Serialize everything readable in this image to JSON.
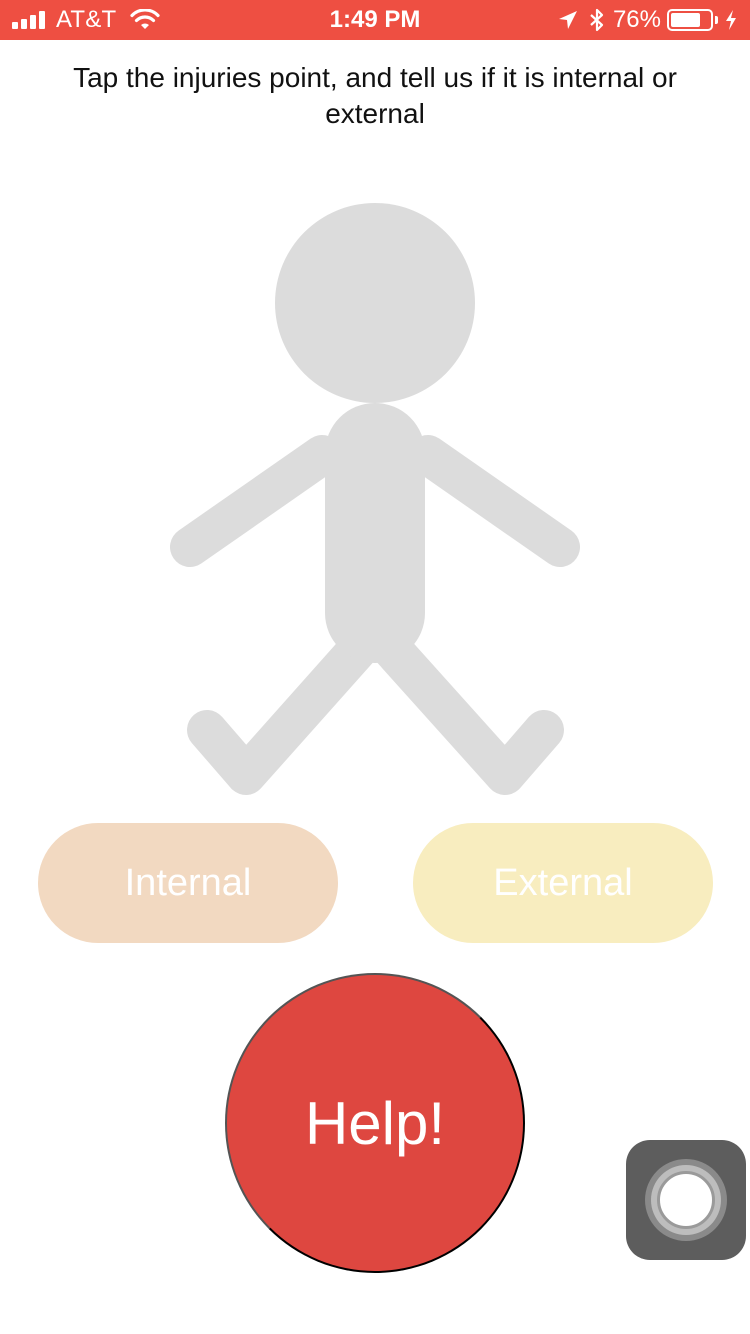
{
  "status_bar": {
    "carrier": "AT&T",
    "time": "1:49 PM",
    "battery_percent": "76%",
    "battery_level": 0.76,
    "background_color": "#ee4f42",
    "icons": [
      "signal-bars-icon",
      "wifi-icon",
      "location-arrow-icon",
      "bluetooth-icon",
      "battery-icon",
      "charging-bolt-icon"
    ]
  },
  "instruction": "Tap the injuries point, and tell us if it is internal or external",
  "body_figure": {
    "color": "#dcdcdc",
    "parts": [
      "head",
      "torso",
      "left-arm",
      "right-arm",
      "left-leg",
      "right-leg"
    ]
  },
  "buttons": {
    "internal_label": "Internal",
    "external_label": "External",
    "help_label": "Help!",
    "internal_color": "#f2d9c1",
    "external_color": "#f8edbf",
    "help_color": "#de4740"
  },
  "assistive_touch": {
    "icon": "assistive-touch-icon"
  }
}
